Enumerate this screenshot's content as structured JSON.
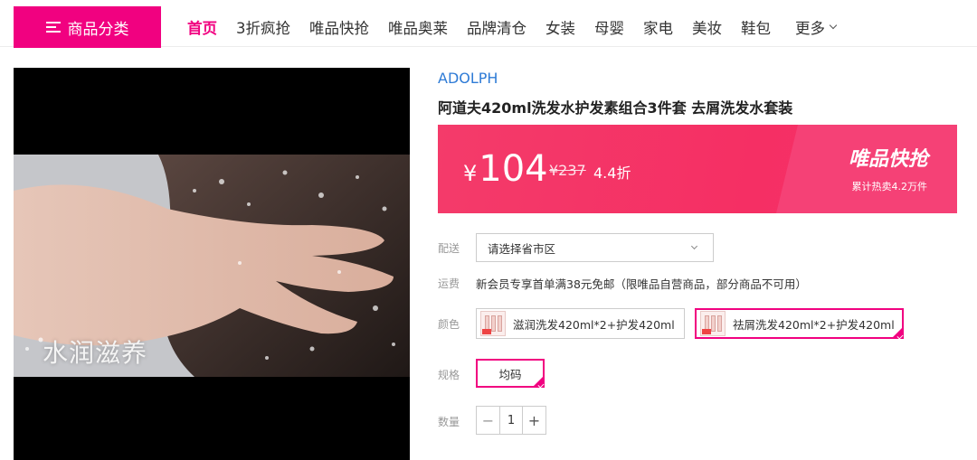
{
  "nav": {
    "category_label": "商品分类",
    "items": [
      "首页",
      "3折疯抢",
      "唯品快抢",
      "唯品奥莱",
      "品牌清仓",
      "女装",
      "母婴",
      "家电",
      "美妆",
      "鞋包"
    ],
    "more_label": "更多"
  },
  "video": {
    "caption": "水润滋养"
  },
  "product": {
    "brand": "ADOLPH",
    "title": "阿道夫420ml洗发水护发素组合3件套 去屑洗发水套装",
    "price_symbol": "¥",
    "price": "104",
    "original_price": "¥237",
    "discount": "4.4折",
    "promo_title": "唯品快抢",
    "promo_sub": "累计热卖4.2万件"
  },
  "delivery": {
    "label": "配送",
    "placeholder": "请选择省市区"
  },
  "shipping": {
    "label": "运费",
    "text": "新会员专享首单满38元免邮（限唯品自营商品，部分商品不可用）"
  },
  "color": {
    "label": "颜色",
    "options": [
      "滋润洗发420ml*2+护发420ml",
      "祛屑洗发420ml*2+护发420ml"
    ],
    "selected_index": 1
  },
  "size": {
    "label": "规格",
    "option": "均码"
  },
  "quantity": {
    "label": "数量",
    "minus": "−",
    "value": "1",
    "plus": "+"
  },
  "colors": {
    "accent": "#f10180",
    "price_bar": "#f52f64",
    "brand_link": "#2e7bd6"
  }
}
